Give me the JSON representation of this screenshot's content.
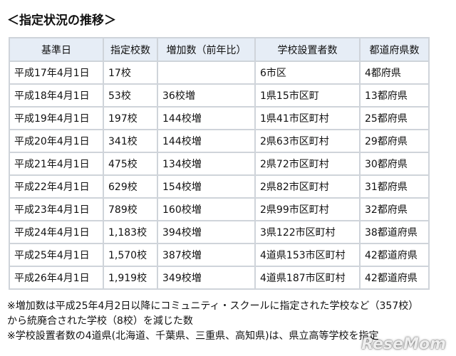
{
  "heading": "＜指定状況の推移＞",
  "table": {
    "headers": [
      "基準日",
      "指定校数",
      "増加数（前年比）",
      "学校設置者数",
      "都道府県数"
    ],
    "rows": [
      [
        "平成17年4月1日",
        "17校",
        "",
        "6市区",
        "4都府県"
      ],
      [
        "平成18年4月1日",
        "53校",
        "36校増",
        "1県15市区町",
        "13都府県"
      ],
      [
        "平成19年4月1日",
        "197校",
        "144校増",
        "1県41市区町村",
        "25都府県"
      ],
      [
        "平成20年4月1日",
        "341校",
        "144校増",
        "2県63市区町村",
        "29都府県"
      ],
      [
        "平成21年4月1日",
        "475校",
        "134校増",
        "2県72市区町村",
        "30都府県"
      ],
      [
        "平成22年4月1日",
        "629校",
        "154校増",
        "2県82市区町村",
        "31都府県"
      ],
      [
        "平成23年4月1日",
        "789校",
        "160校増",
        "2県99市区町村",
        "32都府県"
      ],
      [
        "平成24年4月1日",
        "1,183校",
        "394校増",
        "3県122市区町村",
        "38都道府県"
      ],
      [
        "平成25年4月1日",
        "1,570校",
        "387校増",
        "4道県153市区町村",
        "42都道府県"
      ],
      [
        "平成26年4月1日",
        "1,919校",
        "349校増",
        "4道県187市区町村",
        "42都道府県"
      ]
    ]
  },
  "notes": [
    "※増加数は平成25年4月2日以降にコミュニティ・スクールに指定された学校など（357校）",
    "から統廃合された学校（8校）を減じた数",
    "※学校設置者数の4道県(北海道、千葉県、三重県、高知県)は、県立高等学校を指定"
  ],
  "watermark": "ReseMom"
}
